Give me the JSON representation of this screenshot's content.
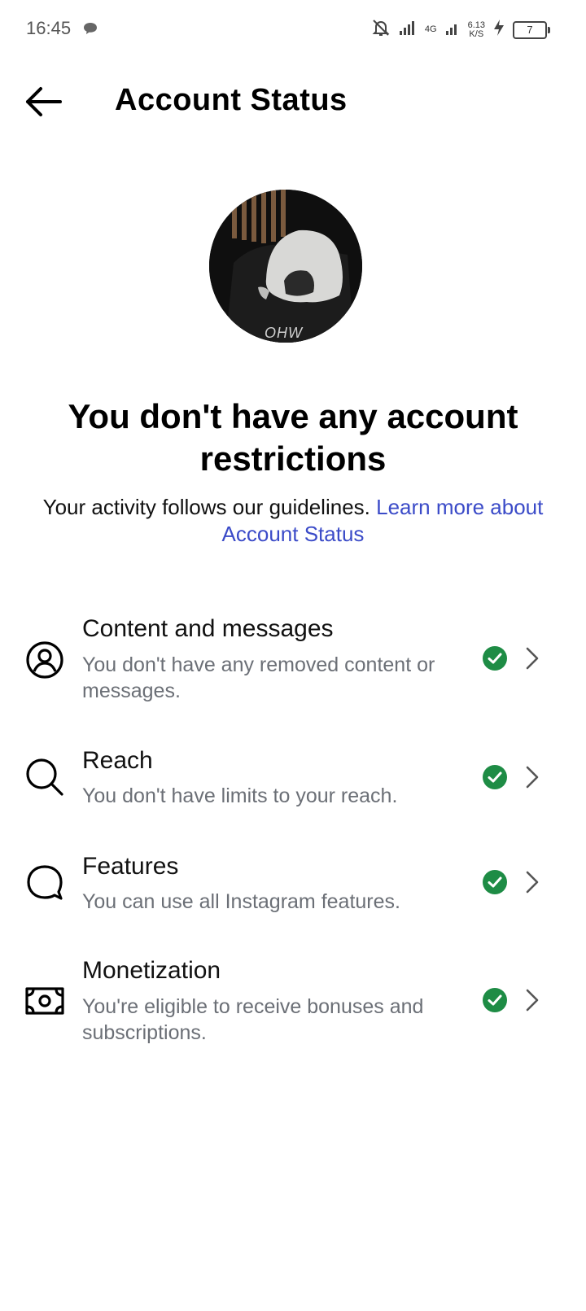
{
  "status_bar": {
    "time": "16:45",
    "network": "4G",
    "speed_value": "6.13",
    "speed_unit": "K/S",
    "battery": "7"
  },
  "header": {
    "title": "Account Status",
    "back_icon": "arrow-left-icon"
  },
  "avatar": {
    "caption": "OHW"
  },
  "main": {
    "headline": "You don't have any account restrictions",
    "subtext": "Your activity follows our guidelines.",
    "learn_more": "Learn more about Account Status"
  },
  "items": [
    {
      "title": "Content and messages",
      "subtitle": "You don't have any removed content or messages.",
      "icon": "user-circle-icon",
      "status": "ok"
    },
    {
      "title": "Reach",
      "subtitle": "You don't have limits to your reach.",
      "icon": "search-icon",
      "status": "ok"
    },
    {
      "title": "Features",
      "subtitle": "You can use all Instagram features.",
      "icon": "chat-bubble-icon",
      "status": "ok"
    },
    {
      "title": "Monetization",
      "subtitle": "You're eligible to receive bonuses and subscriptions.",
      "icon": "money-icon",
      "status": "ok"
    }
  ],
  "colors": {
    "link": "#3b4bc8",
    "ok_green": "#1e8c45",
    "secondary_text": "#6b6f76"
  }
}
